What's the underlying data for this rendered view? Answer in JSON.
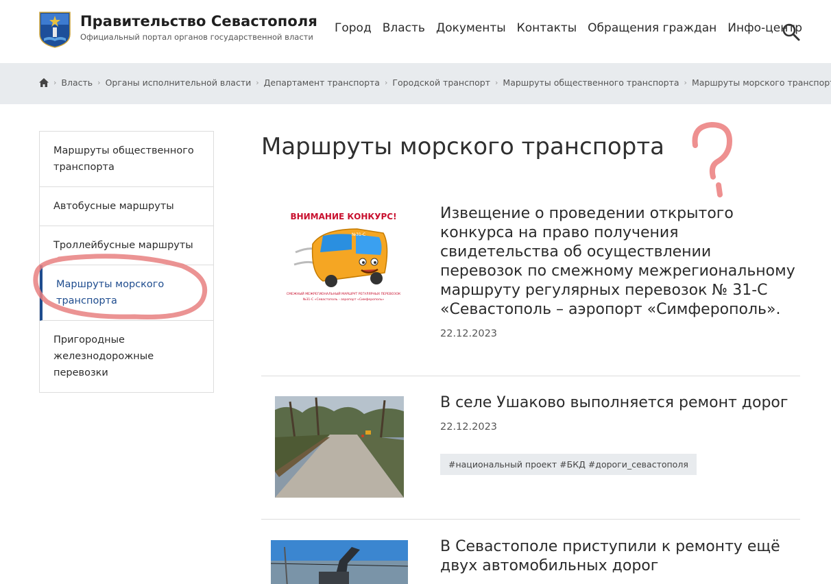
{
  "header": {
    "title": "Правительство Севастополя",
    "subtitle": "Официальный портал органов государственной власти",
    "nav": [
      "Город",
      "Власть",
      "Документы",
      "Контакты",
      "Обращения граждан",
      "Инфо-центр"
    ]
  },
  "breadcrumb": [
    "Власть",
    "Органы исполнительной власти",
    "Департамент транспорта",
    "Городской транспорт",
    "Маршруты общественного транспорта",
    "Маршруты морского транспорта"
  ],
  "sidebar": {
    "items": [
      {
        "label": "Маршруты общественного транспорта"
      },
      {
        "label": "Автобусные маршруты"
      },
      {
        "label": "Троллейбусные маршруты"
      },
      {
        "label": "Маршруты морского транспорта",
        "active": true
      },
      {
        "label": "Пригородные железнодорожные перевозки"
      }
    ]
  },
  "main": {
    "page_title": "Маршруты морского транспорта",
    "news": [
      {
        "title": "Извещение о проведении открытого конкурса на право получения свидетельства об осуществлении перевозок по смежному межрегиональному маршруту регулярных перевозок № 31-С «Севастополь – аэропорт «Симферополь».",
        "date": "22.12.2023",
        "image": {
          "banner": "ВНИМАНИЕ КОНКУРС!",
          "bus_label": "№31-С",
          "caption_1": "СМЕЖНЫЙ МЕЖРЕГИОНАЛЬНЫЙ МАРШРУТ РЕГУЛЯРНЫХ ПЕРЕВОЗОК",
          "caption_2": "№31-С «Севастополь - аэропорт «Симферополь»"
        }
      },
      {
        "title": "В селе Ушаково выполняется ремонт дорог",
        "date": "22.12.2023",
        "tags": "#национальный проект #БКД #дороги_севастополя"
      },
      {
        "title": "В Севастополе приступили к ремонту ещё двух автомобильных дорог"
      }
    ]
  },
  "colors": {
    "accent": "#1e4c8e",
    "annotation": "#e88080",
    "breadcrumb_bg": "#e8ebee"
  }
}
